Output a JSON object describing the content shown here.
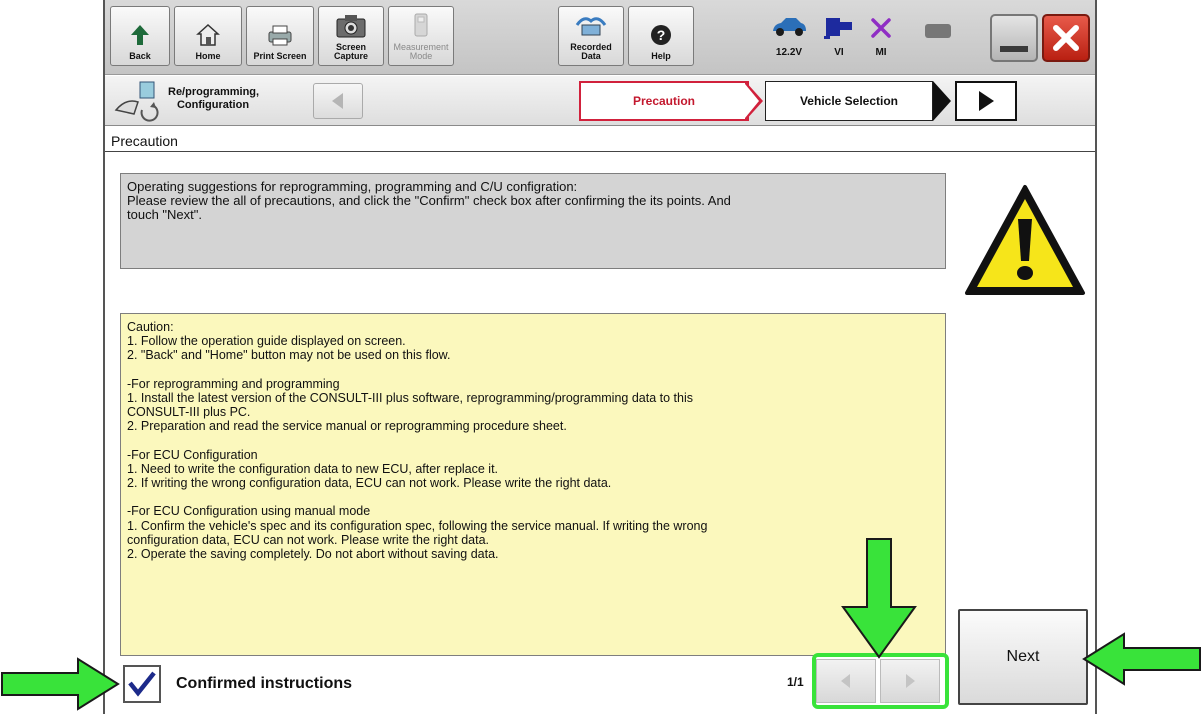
{
  "toolbar": {
    "buttons": [
      {
        "label": "Back",
        "icon": "back-arrow-icon"
      },
      {
        "label": "Home",
        "icon": "home-icon"
      },
      {
        "label": "Print Screen",
        "icon": "printer-icon"
      },
      {
        "label": "Screen\nCapture",
        "icon": "camera-icon"
      },
      {
        "label": "Measurement\nMode",
        "icon": "measurement-icon"
      },
      {
        "label": "Recorded\nData",
        "icon": "recorded-data-icon"
      },
      {
        "label": "Help",
        "icon": "help-icon"
      }
    ],
    "status": {
      "battery_voltage": "12.2V",
      "vi_label": "VI",
      "mi_label": "MI"
    }
  },
  "navbar": {
    "mode_label": "Re/programming,\nConfiguration",
    "crumbs": [
      "Precaution",
      "Vehicle Selection"
    ]
  },
  "section": {
    "title": "Precaution"
  },
  "info_text": [
    "Operating suggestions for reprogramming, programming and C/U configration:",
    "Please review the all of precautions, and click the \"Confirm\" check box after confirming the its points. And",
    "touch \"Next\"."
  ],
  "caution_lines": [
    "Caution:",
    "1. Follow the operation guide displayed on screen.",
    "2. \"Back\" and  \"Home\" button may not be used on this flow.",
    "",
    "-For reprogramming and programming",
    "1. Install the latest version of the CONSULT-III plus software, reprogramming/programming data to this",
    "CONSULT-III plus PC.",
    "2. Preparation and read the service manual or reprogramming procedure sheet.",
    "",
    "-For ECU Configuration",
    "1. Need to write the configuration data to new ECU, after replace it.",
    "2. If writing the wrong configuration data, ECU can not work. Please write the right data.",
    "",
    "-For ECU Configuration using manual mode",
    "1. Confirm the vehicle's spec and its configuration spec, following the service manual.  If writing the wrong",
    "configuration data, ECU can not work. Please write the right data.",
    "2. Operate the saving completely. Do not abort without saving data."
  ],
  "footer": {
    "confirm_label": "Confirmed instructions",
    "confirm_checked": true,
    "page_indicator": "1/1",
    "next_label": "Next"
  },
  "colors": {
    "highlight_green": "#39e33a",
    "active_crumb_red": "#d1213c",
    "caution_bg": "#fbf8bd",
    "info_bg": "#d4d4d4",
    "check_blue": "#1c2a8a"
  }
}
